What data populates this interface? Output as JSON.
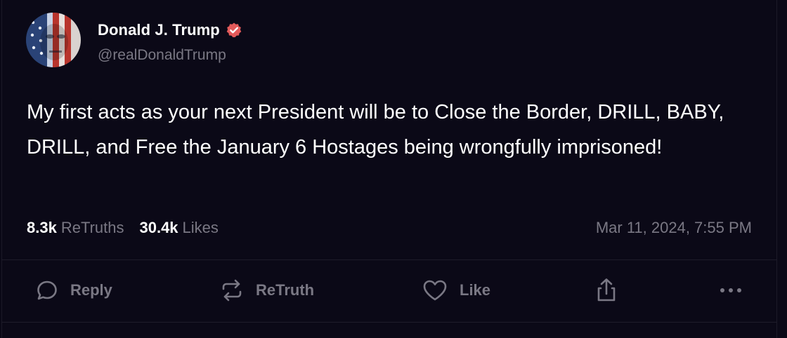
{
  "author": {
    "display_name": "Donald J. Trump",
    "handle": "@realDonaldTrump",
    "verified": true
  },
  "post": {
    "text": "My first acts as your next President will be to Close the Border, DRILL, BABY, DRILL, and Free the January 6 Hostages being wrongfully imprisoned!",
    "retruths_count": "8.3k",
    "retruths_label": "ReTruths",
    "likes_count": "30.4k",
    "likes_label": "Likes",
    "timestamp": "Mar 11, 2024, 7:55 PM"
  },
  "actions": {
    "reply_label": "Reply",
    "retruth_label": "ReTruth",
    "like_label": "Like"
  },
  "icons": {
    "verified": "verified-badge-icon",
    "reply": "speech-bubble-icon",
    "retruth": "repost-arrows-icon",
    "like": "heart-icon",
    "share": "share-upload-icon",
    "more": "ellipsis-icon"
  },
  "colors": {
    "background": "#0b0917",
    "text_primary": "#ffffff",
    "text_secondary": "#7a7884",
    "verified_badge": "#e35a5a"
  }
}
